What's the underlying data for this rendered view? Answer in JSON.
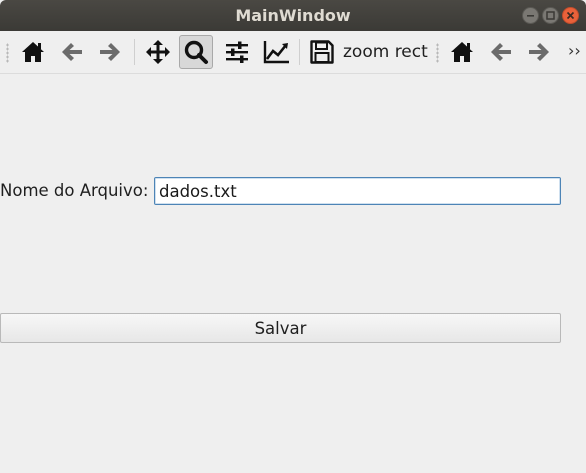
{
  "window": {
    "title": "MainWindow"
  },
  "toolbar": {
    "items": [
      {
        "name": "home-icon",
        "tooltip": "Home"
      },
      {
        "name": "back-arrow-icon",
        "tooltip": "Back"
      },
      {
        "name": "forward-arrow-icon",
        "tooltip": "Forward"
      },
      {
        "name": "pan-icon",
        "tooltip": "Pan"
      },
      {
        "name": "zoom-icon",
        "tooltip": "Zoom",
        "active": true
      },
      {
        "name": "subplots-icon",
        "tooltip": "Subplots"
      },
      {
        "name": "edit-axis-icon",
        "tooltip": "Customize"
      },
      {
        "name": "save-icon",
        "tooltip": "Save"
      }
    ],
    "mode_label": "zoom rect",
    "overflow_label": "››"
  },
  "form": {
    "file_label": "Nome do Arquivo:",
    "file_value": "dados.txt",
    "save_label": "Salvar"
  },
  "colors": {
    "titlebar": "#3f3e3a",
    "close_button": "#e9613a",
    "input_focus_border": "#4d84b6",
    "icon": "#1a1a1a",
    "icon_gray": "#6b6b6b"
  }
}
